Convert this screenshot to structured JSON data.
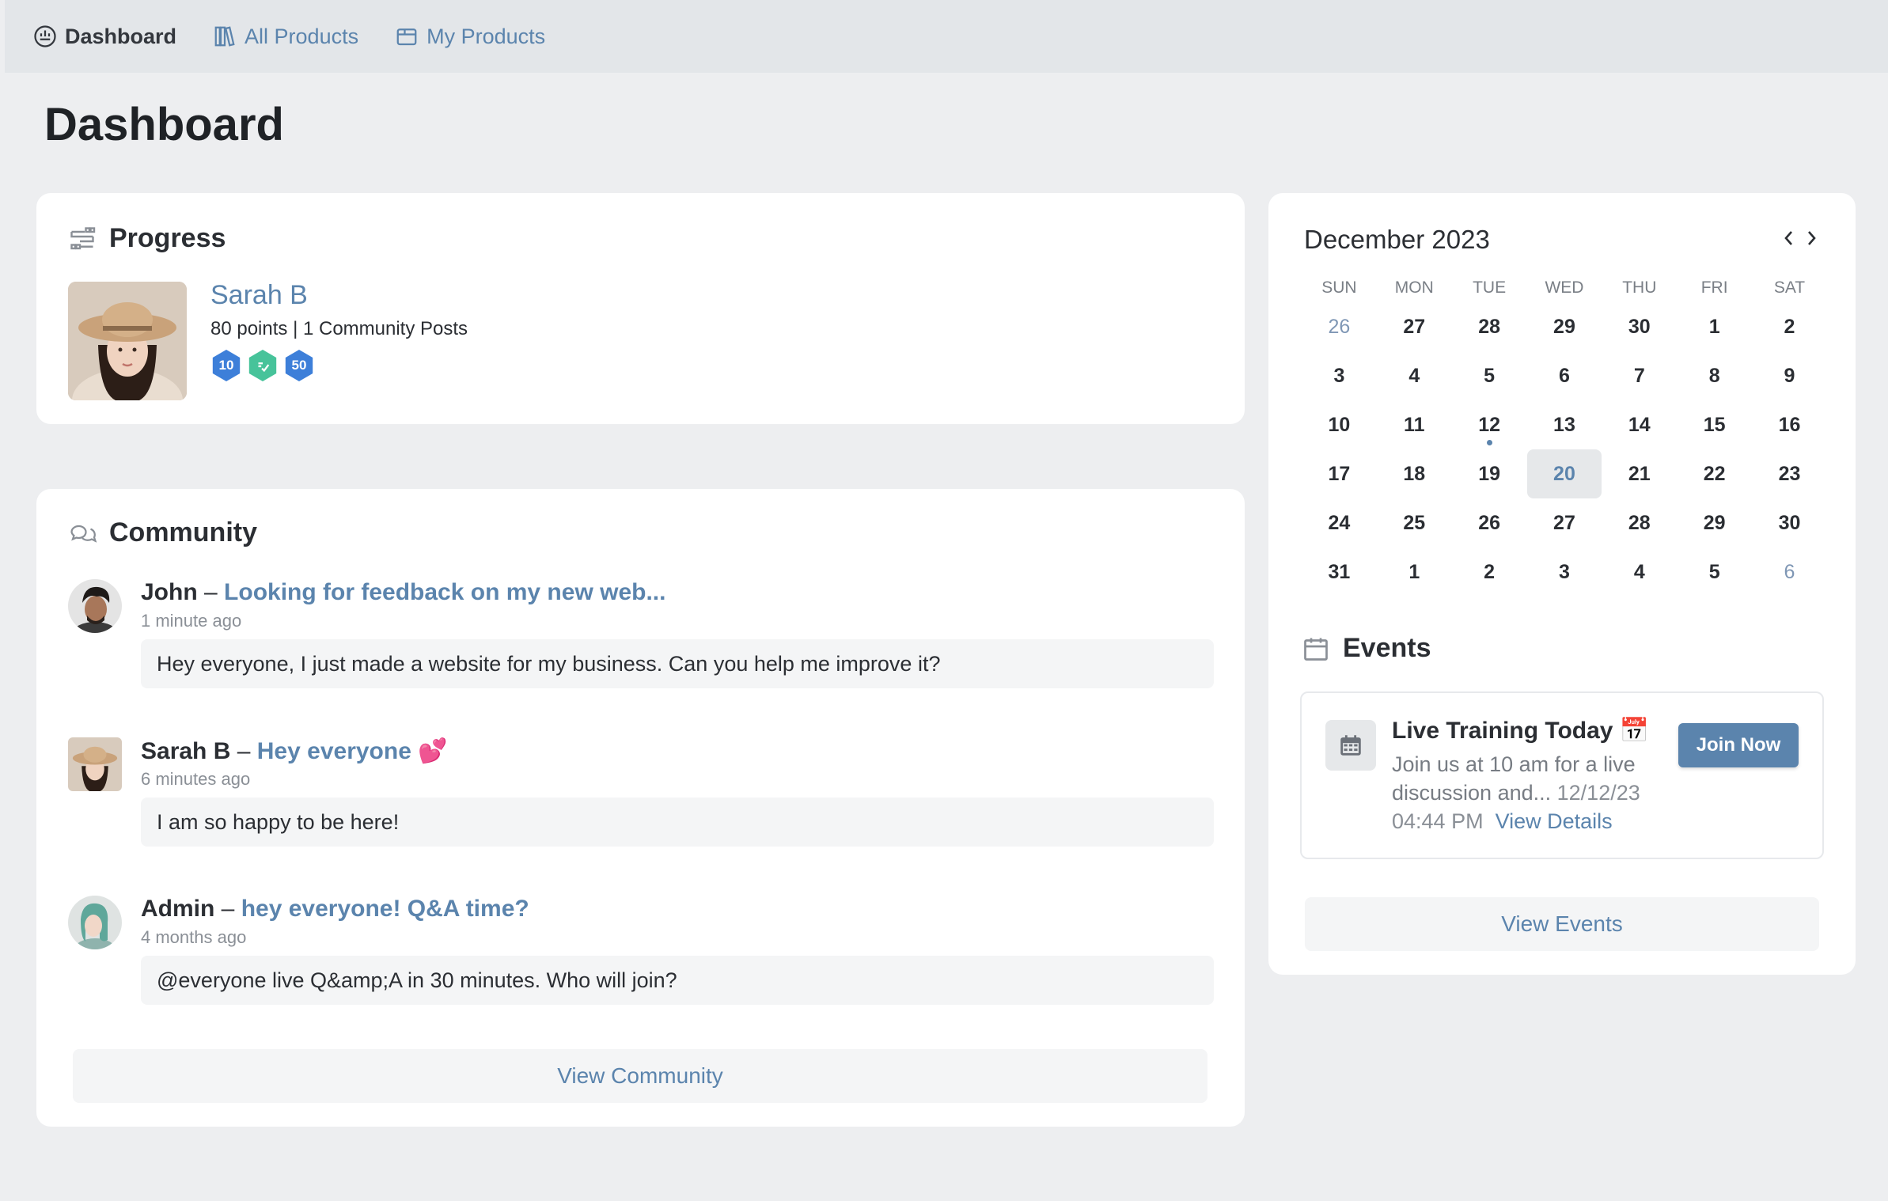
{
  "nav": {
    "items": [
      {
        "label": "Dashboard",
        "icon": "dashboard-gauge-icon",
        "active": true
      },
      {
        "label": "All Products",
        "icon": "library-books-icon",
        "active": false
      },
      {
        "label": "My Products",
        "icon": "box-icon",
        "active": false
      }
    ]
  },
  "page": {
    "title": "Dashboard"
  },
  "progress": {
    "header": "Progress",
    "user": {
      "name": "Sarah B",
      "stats": "80 points | 1 Community Posts",
      "badges": [
        {
          "label": "10",
          "color": "#3d7fd9"
        },
        {
          "label": "",
          "color": "#47c39a",
          "icon": "check-badge-icon"
        },
        {
          "label": "50",
          "color": "#3d7fd9"
        }
      ]
    }
  },
  "community": {
    "header": "Community",
    "posts": [
      {
        "author": "John",
        "separator": "–",
        "title": "Looking for feedback on my new web...",
        "time": "1 minute ago",
        "body": "Hey everyone, I just made a website for my business. Can you help me improve it?"
      },
      {
        "author": "Sarah B",
        "separator": "–",
        "title": "Hey everyone 💕",
        "time": "6 minutes ago",
        "body": "I am so happy to be here!"
      },
      {
        "author": "Admin",
        "separator": "–",
        "title": "hey everyone! Q&A time?",
        "time": "4 months ago",
        "body": "@everyone live Q&amp;A in 30 minutes. Who will join?"
      }
    ],
    "view_button": "View Community"
  },
  "calendar": {
    "month_label": "December 2023",
    "weekdays": [
      "SUN",
      "MON",
      "TUE",
      "WED",
      "THU",
      "FRI",
      "SAT"
    ],
    "weeks": [
      [
        "26",
        "27",
        "28",
        "29",
        "30",
        "1",
        "2"
      ],
      [
        "3",
        "4",
        "5",
        "6",
        "7",
        "8",
        "9"
      ],
      [
        "10",
        "11",
        "12",
        "13",
        "14",
        "15",
        "16"
      ],
      [
        "17",
        "18",
        "19",
        "20",
        "21",
        "22",
        "23"
      ],
      [
        "24",
        "25",
        "26",
        "27",
        "28",
        "29",
        "30"
      ],
      [
        "31",
        "1",
        "2",
        "3",
        "4",
        "5",
        "6"
      ]
    ],
    "today": "20",
    "event_day": "12"
  },
  "events": {
    "header": "Events",
    "items": [
      {
        "title": "Live Training Today 📅",
        "description": "Join us at 10 am for a live discussion and...",
        "date": "12/12/23",
        "time": "04:44 PM",
        "details_link": "View Details",
        "button": "Join Now"
      }
    ],
    "view_button": "View Events"
  },
  "colors": {
    "accent": "#5b84ad",
    "page_bg": "#edeef0",
    "nav_bg": "#e3e6e9",
    "card_bg": "#ffffff"
  }
}
